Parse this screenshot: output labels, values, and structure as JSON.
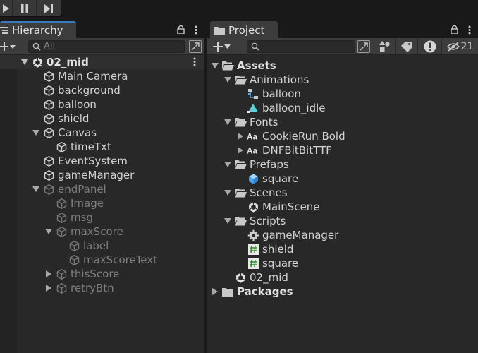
{
  "colors": {
    "panel": "#282828",
    "toolbar": "#3c3c3c",
    "accent": "#3a79bb",
    "text": "#d2d2d2",
    "dim": "#7e7e7e"
  },
  "hierarchy": {
    "tab_label": "Hierarchy",
    "search_placeholder": "All",
    "scene_name": "02_mid",
    "items": [
      {
        "label": "Main Camera",
        "depth": 1,
        "arrow": "none",
        "dim": false
      },
      {
        "label": "background",
        "depth": 1,
        "arrow": "none",
        "dim": false
      },
      {
        "label": "balloon",
        "depth": 1,
        "arrow": "none",
        "dim": false
      },
      {
        "label": "shield",
        "depth": 1,
        "arrow": "none",
        "dim": false
      },
      {
        "label": "Canvas",
        "depth": 1,
        "arrow": "down",
        "dim": false
      },
      {
        "label": "timeTxt",
        "depth": 2,
        "arrow": "none",
        "dim": false
      },
      {
        "label": "EventSystem",
        "depth": 1,
        "arrow": "none",
        "dim": false
      },
      {
        "label": "gameManager",
        "depth": 1,
        "arrow": "none",
        "dim": false
      },
      {
        "label": "endPanel",
        "depth": 1,
        "arrow": "down",
        "dim": true
      },
      {
        "label": "Image",
        "depth": 2,
        "arrow": "none",
        "dim": true
      },
      {
        "label": "msg",
        "depth": 2,
        "arrow": "none",
        "dim": true
      },
      {
        "label": "maxScore",
        "depth": 2,
        "arrow": "down",
        "dim": true
      },
      {
        "label": "label",
        "depth": 3,
        "arrow": "none",
        "dim": true
      },
      {
        "label": "maxScoreText",
        "depth": 3,
        "arrow": "none",
        "dim": true
      },
      {
        "label": "thisScore",
        "depth": 2,
        "arrow": "right",
        "dim": true
      },
      {
        "label": "retryBtn",
        "depth": 2,
        "arrow": "right",
        "dim": true
      }
    ]
  },
  "project": {
    "tab_label": "Project",
    "search_placeholder": "",
    "hidden_count": "21",
    "items": [
      {
        "label": "Assets",
        "depth": 0,
        "arrow": "down",
        "icon": "folder-open",
        "bold": true
      },
      {
        "label": "Animations",
        "depth": 1,
        "arrow": "down",
        "icon": "folder-open",
        "bold": false
      },
      {
        "label": "balloon",
        "depth": 2,
        "arrow": "none",
        "icon": "animator-controller",
        "bold": false
      },
      {
        "label": "balloon_idle",
        "depth": 2,
        "arrow": "none",
        "icon": "animation-clip",
        "bold": false
      },
      {
        "label": "Fonts",
        "depth": 1,
        "arrow": "down",
        "icon": "folder-open",
        "bold": false
      },
      {
        "label": "CookieRun Bold",
        "depth": 2,
        "arrow": "right",
        "icon": "font",
        "bold": false
      },
      {
        "label": "DNFBitBitTTF",
        "depth": 2,
        "arrow": "right",
        "icon": "font",
        "bold": false
      },
      {
        "label": "Prefaps",
        "depth": 1,
        "arrow": "down",
        "icon": "folder-open",
        "bold": false
      },
      {
        "label": "square",
        "depth": 2,
        "arrow": "none",
        "icon": "prefab",
        "bold": false
      },
      {
        "label": "Scenes",
        "depth": 1,
        "arrow": "down",
        "icon": "folder-open",
        "bold": false
      },
      {
        "label": "MainScene",
        "depth": 2,
        "arrow": "none",
        "icon": "unity-scene",
        "bold": false
      },
      {
        "label": "Scripts",
        "depth": 1,
        "arrow": "down",
        "icon": "folder-open",
        "bold": false
      },
      {
        "label": "gameManager",
        "depth": 2,
        "arrow": "none",
        "icon": "gear",
        "bold": false
      },
      {
        "label": "shield",
        "depth": 2,
        "arrow": "none",
        "icon": "csharp-script",
        "bold": false
      },
      {
        "label": "square",
        "depth": 2,
        "arrow": "none",
        "icon": "csharp-script",
        "bold": false
      },
      {
        "label": "02_mid",
        "depth": 1,
        "arrow": "none",
        "icon": "unity-scene",
        "bold": false
      },
      {
        "label": "Packages",
        "depth": 0,
        "arrow": "right",
        "icon": "folder-closed",
        "bold": true
      }
    ]
  }
}
